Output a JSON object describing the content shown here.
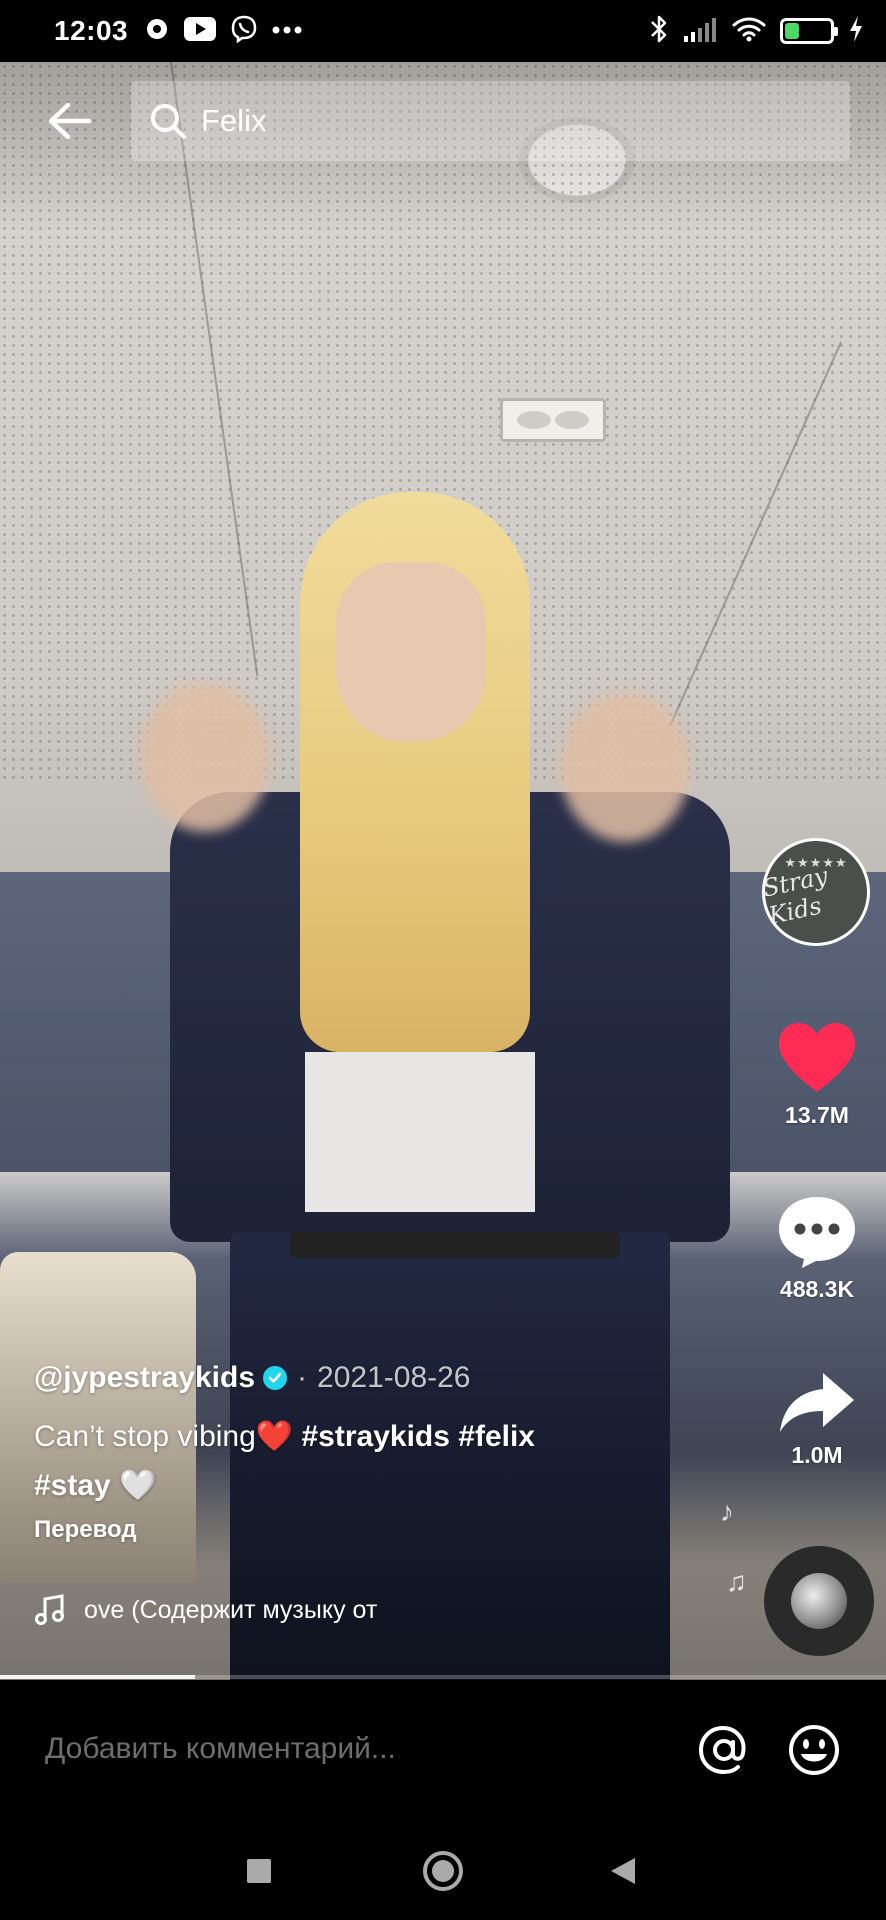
{
  "status_bar": {
    "time": "12:03",
    "battery_percent": "30",
    "battery_level": 0.3,
    "left_icons": [
      "notification-icon",
      "youtube-icon",
      "viber-icon",
      "more-dots-icon"
    ],
    "right_icons": [
      "bluetooth-icon",
      "signal-icon",
      "wifi-icon",
      "battery-icon",
      "charging-icon"
    ]
  },
  "search": {
    "query": "Felix"
  },
  "video": {
    "author": "@jypestraykids",
    "verified": true,
    "date_separator": "·",
    "date": "2021-08-26",
    "description_text": "Can’t stop vibing",
    "description_heart": "❤️",
    "tags_line1": "#straykids #felix",
    "tags_line2": "#stay",
    "tags_line2_heart": "🤍",
    "translate_label": "Перевод",
    "music_text": "ove (Содержит музыку от",
    "progress": 0.22
  },
  "rail": {
    "avatar_text": "Stray Kids",
    "likes": "13.7M",
    "comments": "488.3K",
    "shares": "1.0M"
  },
  "comment_bar": {
    "placeholder": "Добавить комментарий..."
  },
  "colors": {
    "like": "#fe2c55",
    "verified": "#20d5ec",
    "battery_fill": "#4cd964"
  }
}
